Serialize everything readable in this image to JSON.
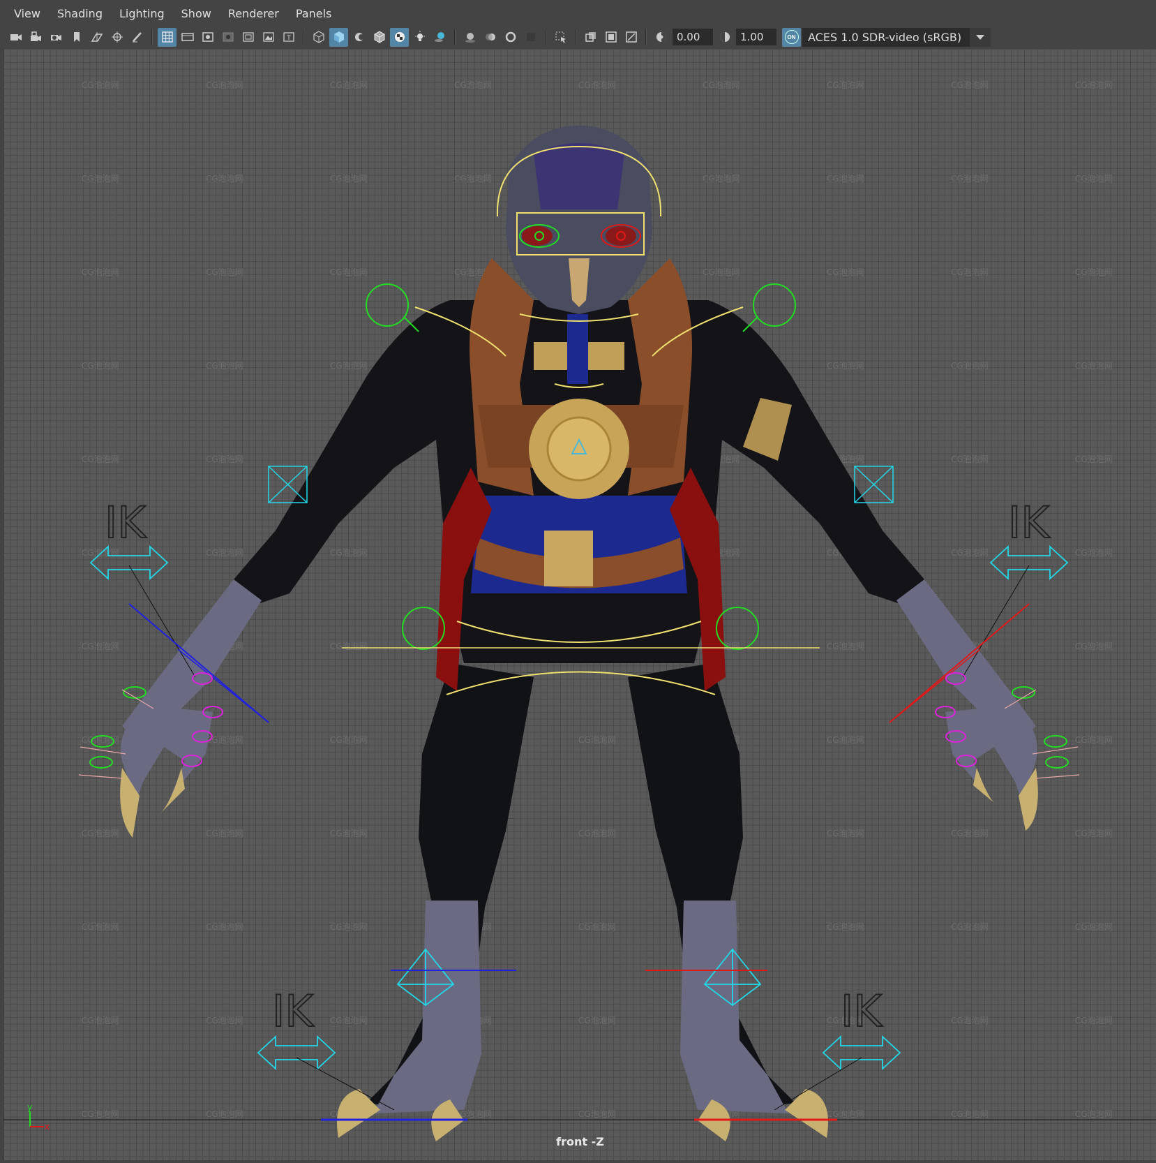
{
  "menubar": {
    "items": [
      "View",
      "Shading",
      "Lighting",
      "Show",
      "Renderer",
      "Panels"
    ]
  },
  "toolbar": {
    "exposure_value": "0.00",
    "gamma_value": "1.00",
    "color_management_badge": "ON",
    "color_space": "ACES 1.0 SDR-video (sRGB)",
    "icons": [
      "camera-icon",
      "camera-lock-icon",
      "camera-attributes-icon",
      "bookmark-icon",
      "image-plane-icon",
      "2d-pan-zoom-icon",
      "grease-pencil-icon",
      "grid-icon",
      "film-gate-icon",
      "resolution-gate-icon",
      "gate-mask-icon",
      "field-chart-icon",
      "safe-action-icon",
      "safe-title-icon",
      "wireframe-icon",
      "smooth-shade-icon",
      "use-default-material-icon",
      "wireframe-on-shaded-icon",
      "textured-icon",
      "lights-icon",
      "shadows-icon",
      "screen-space-ao-icon",
      "motion-blur-icon",
      "anti-aliasing-icon",
      "depth-of-field-icon",
      "isolate-select-icon",
      "xray-icon",
      "xray-joints-icon",
      "xray-components-icon",
      "exposure-icon",
      "gamma-icon"
    ]
  },
  "viewport": {
    "camera_label": "front -Z",
    "ik_labels": [
      "IK",
      "IK",
      "IK",
      "IK"
    ],
    "watermark": "CG泡泡网",
    "axis_y": "y",
    "axis_x": "x"
  },
  "colors": {
    "selection_highlight": "#5285a6",
    "ctrl_green": "#22dd22",
    "ctrl_cyan": "#22d8e8",
    "ctrl_yellow": "#f0e070",
    "ctrl_magenta": "#dd22dd",
    "ctrl_red": "#e01818",
    "ctrl_blue": "#2020e0"
  }
}
